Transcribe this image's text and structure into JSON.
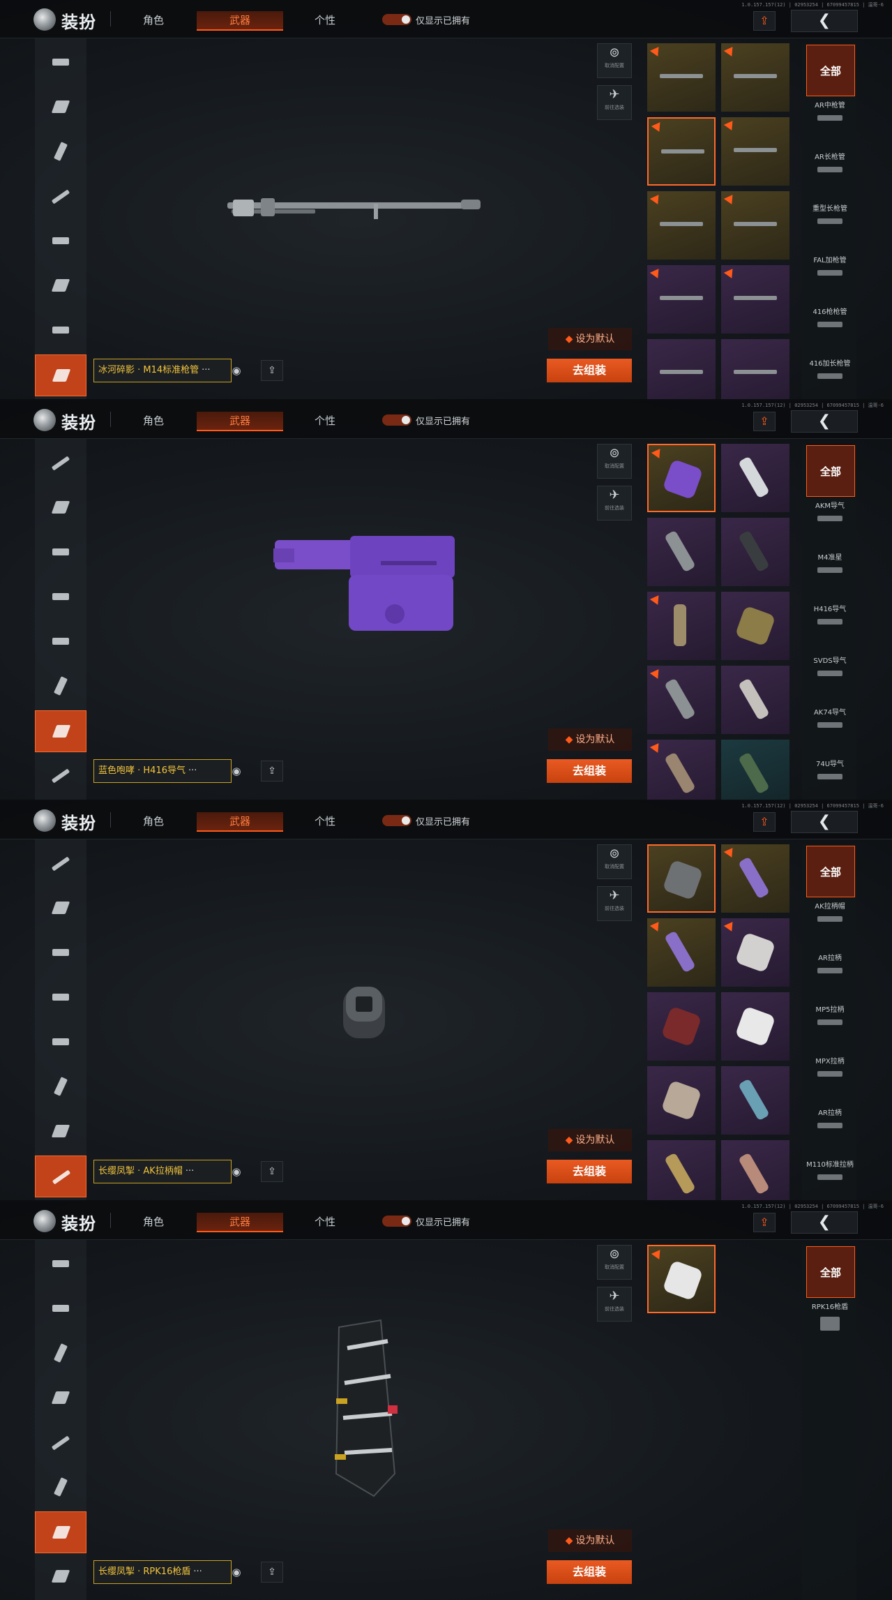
{
  "header": {
    "version": "1.0.157.157(12) | 02953254 | 67099457815 | 温哥-6",
    "title": "装扮",
    "tabs": [
      "角色",
      "武器",
      "个性"
    ],
    "active_tab": "武器",
    "toggle_label": "仅显示已拥有",
    "share_icon": "share-icon",
    "back_icon": "chevron-left-icon"
  },
  "controls": {
    "cancel_label": "取消配置",
    "goto_label": "前往选装"
  },
  "buttons": {
    "set_default": "设为默认",
    "assemble": "去组装"
  },
  "panels": [
    {
      "item_name": "冰河碎影 · M14标准枪管",
      "filters": [
        "全部",
        "AR中枪管",
        "AR长枪管",
        "重型长枪管",
        "FAL加枪管",
        "416枪枪管",
        "416加长枪管"
      ],
      "cells": [
        "gold",
        "gold",
        "gold",
        "gold",
        "gold",
        "gold",
        "purple",
        "purple",
        "purple",
        "purple"
      ]
    },
    {
      "item_name": "蓝色咆哮 · H416导气",
      "filters": [
        "全部",
        "AKM导气",
        "M4准星",
        "H416导气",
        "SVDS导气",
        "AK74导气",
        "74U导气"
      ],
      "cells": [
        "gold",
        "purple",
        "purple",
        "purple",
        "purple",
        "purple",
        "purple",
        "purple",
        "purple",
        "teal"
      ]
    },
    {
      "item_name": "长缨凤掣 · AK拉柄帽",
      "filters": [
        "全部",
        "AK拉柄帽",
        "AR拉柄",
        "MP5拉柄",
        "MPX拉柄",
        "AR拉柄",
        "M110标准拉柄"
      ],
      "cells": [
        "gold",
        "gold",
        "gold",
        "purple",
        "purple",
        "purple",
        "purple",
        "purple",
        "purple",
        "purple"
      ]
    },
    {
      "item_name": "长缨凤掣 · RPK16枪盾",
      "filters": [
        "全部",
        "RPK16枪盾"
      ],
      "cells": [
        "gold"
      ]
    }
  ]
}
